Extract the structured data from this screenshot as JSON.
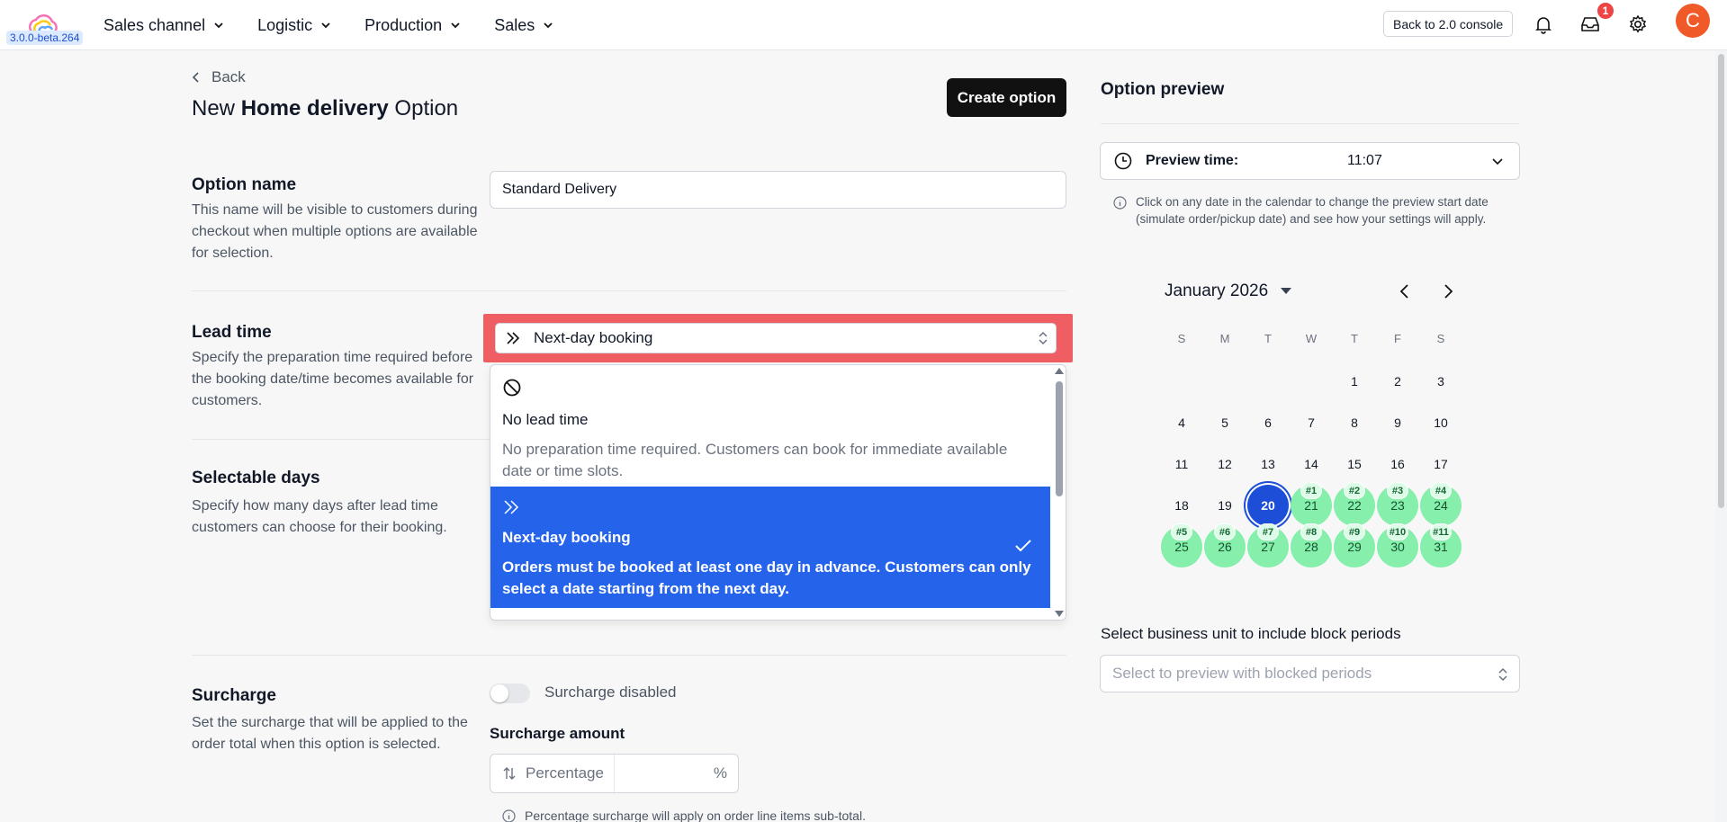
{
  "app": {
    "version": "3.0.0-beta.264",
    "nav": [
      {
        "label": "Sales channel"
      },
      {
        "label": "Logistic"
      },
      {
        "label": "Production"
      },
      {
        "label": "Sales"
      }
    ],
    "console_button": "Back to 2.0 console",
    "notifications_count": "1",
    "avatar_initial": "C",
    "colors": {
      "accent": "#2563eb",
      "brand_avatar": "#f05a28",
      "highlight": "#ef5e63",
      "available_day": "#86efac"
    }
  },
  "header": {
    "back_label": "Back",
    "title_prefix": "New ",
    "title_bold": "Home delivery",
    "title_suffix": " Option",
    "create_button": "Create option"
  },
  "option_name": {
    "title": "Option name",
    "description": "This name will be visible to customers during checkout when multiple options are available for selection.",
    "value": "Standard Delivery"
  },
  "lead_time": {
    "title": "Lead time",
    "description": "Specify the preparation time required before the booking date/time becomes available for customers.",
    "selected": "Next-day booking",
    "options": [
      {
        "icon": "no-entry-icon",
        "label": "No lead time",
        "description": "No preparation time required. Customers can book for immediate available date or time slots."
      },
      {
        "icon": "double-chevron-right-icon",
        "label": "Next-day booking",
        "description": "Orders must be booked at least one day in advance. Customers can only select a date starting from the next day."
      }
    ]
  },
  "selectable_days": {
    "title": "Selectable days",
    "description": "Specify how many days after lead time customers can choose for their booking."
  },
  "surcharge": {
    "title": "Surcharge",
    "description": "Set the surcharge that will be applied to the order total when this option is selected.",
    "toggle_label": "Surcharge disabled",
    "enabled": false,
    "amount_label": "Surcharge amount",
    "amount_type": "Percentage",
    "amount_unit": "%",
    "info": "Percentage surcharge will apply on order line items sub-total."
  },
  "preview": {
    "title": "Option preview",
    "time_label": "Preview time:",
    "time_value": "11:07",
    "info": "Click on any date in the calendar to change the preview start date (simulate order/pickup date) and see how your settings will apply.",
    "month": "January 2026",
    "weekdays": [
      "S",
      "M",
      "T",
      "W",
      "T",
      "F",
      "S"
    ],
    "first_weekday_index": 4,
    "days_in_month": 31,
    "selected_day": 20,
    "slots": [
      {
        "day": 21,
        "label": "#1"
      },
      {
        "day": 22,
        "label": "#2"
      },
      {
        "day": 23,
        "label": "#3"
      },
      {
        "day": 24,
        "label": "#4"
      },
      {
        "day": 25,
        "label": "#5"
      },
      {
        "day": 26,
        "label": "#6"
      },
      {
        "day": 27,
        "label": "#7"
      },
      {
        "day": 28,
        "label": "#8"
      },
      {
        "day": 29,
        "label": "#9"
      },
      {
        "day": 30,
        "label": "#10"
      },
      {
        "day": 31,
        "label": "#11"
      }
    ],
    "business_unit_label": "Select business unit to include block periods",
    "business_unit_placeholder": "Select to preview with blocked periods"
  }
}
